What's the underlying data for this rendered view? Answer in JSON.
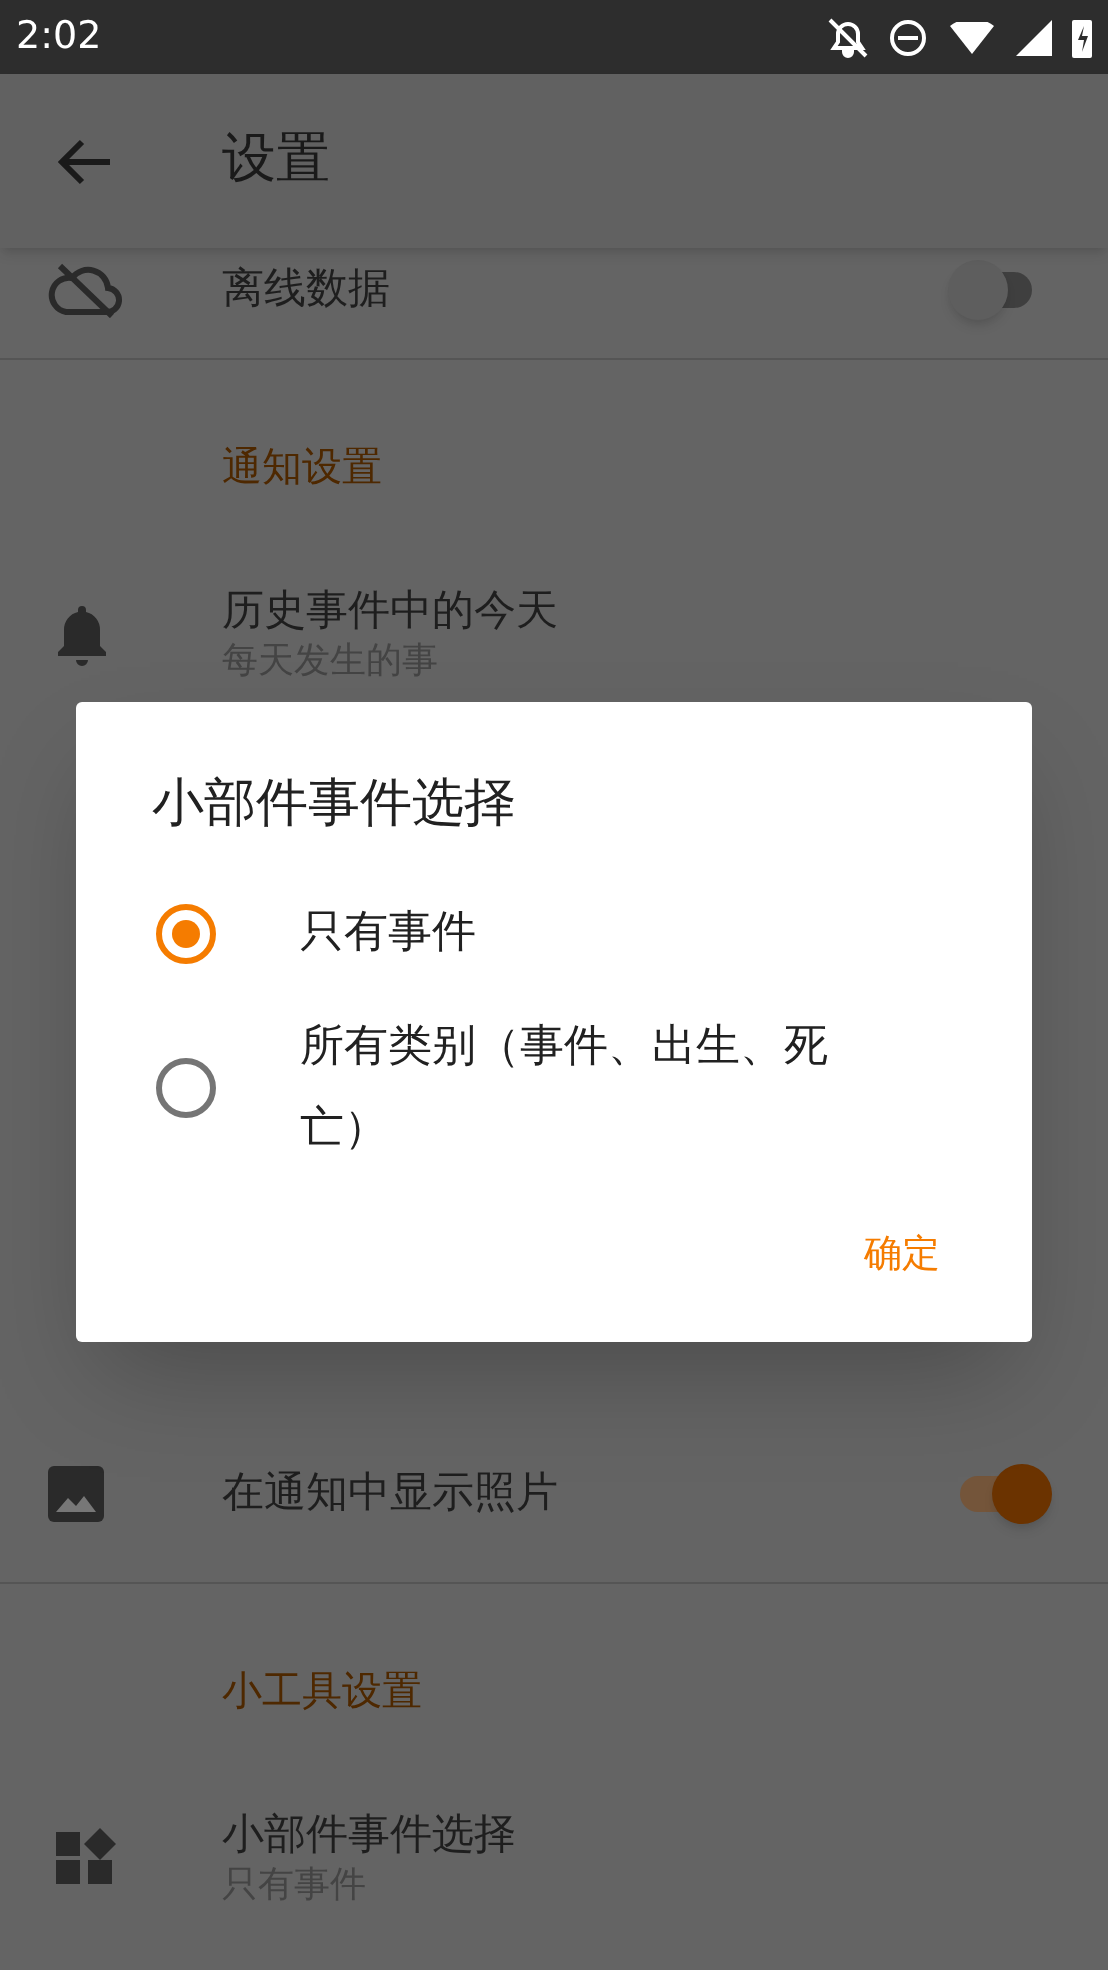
{
  "status_bar": {
    "time": "2:02"
  },
  "app_bar": {
    "title": "设置"
  },
  "settings": [
    {
      "kind": "toggle",
      "title": "离线数据",
      "on": false
    },
    {
      "kind": "header",
      "title": "通知设置"
    },
    {
      "kind": "item",
      "title": "历史事件中的今天",
      "subtitle": "每天发生的事"
    },
    {
      "kind": "obscured"
    },
    {
      "kind": "obscured"
    },
    {
      "kind": "obscured"
    },
    {
      "kind": "toggle",
      "title": "在通知中显示照片",
      "on": true
    },
    {
      "kind": "header",
      "title": "小工具设置"
    },
    {
      "kind": "item",
      "title": "小部件事件选择",
      "subtitle": "只有事件"
    }
  ],
  "dialog": {
    "title": "小部件事件选择",
    "options": [
      {
        "label": "只有事件",
        "selected": true
      },
      {
        "label": "所有类别（事件、出生、死亡）",
        "selected": false
      }
    ],
    "button": "确定"
  }
}
